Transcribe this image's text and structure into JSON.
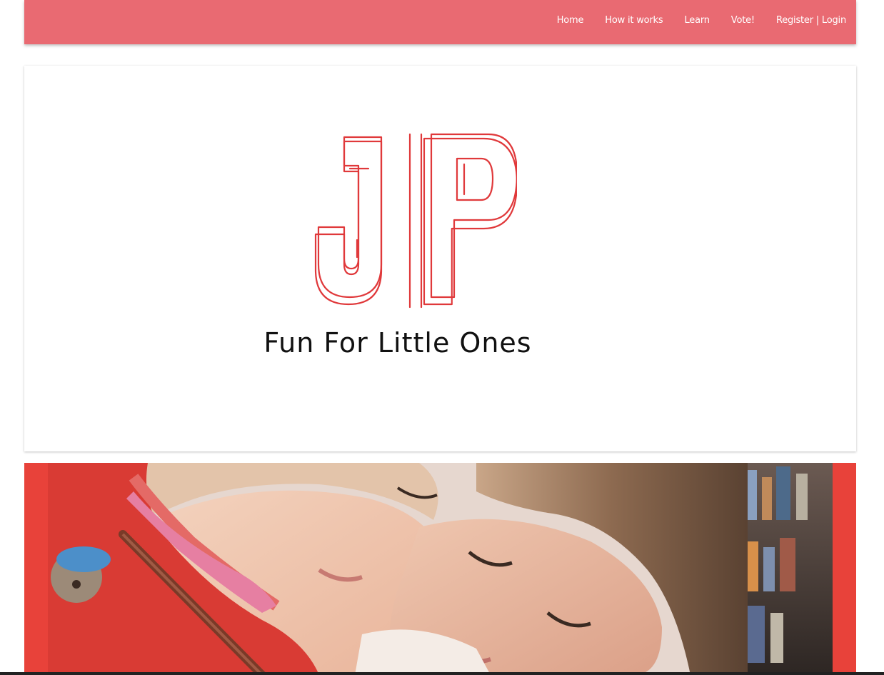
{
  "nav": {
    "items": [
      {
        "label": "Home"
      },
      {
        "label": "How it works"
      },
      {
        "label": "Learn"
      },
      {
        "label": "Vote!"
      },
      {
        "label": "Register | Login"
      }
    ]
  },
  "logo": {
    "letters": "JP",
    "tagline": "Fun For Little Ones"
  },
  "colors": {
    "navbar": "#e96a72",
    "logo_stroke": "#e0393b",
    "hero_frame": "#e8423a"
  }
}
